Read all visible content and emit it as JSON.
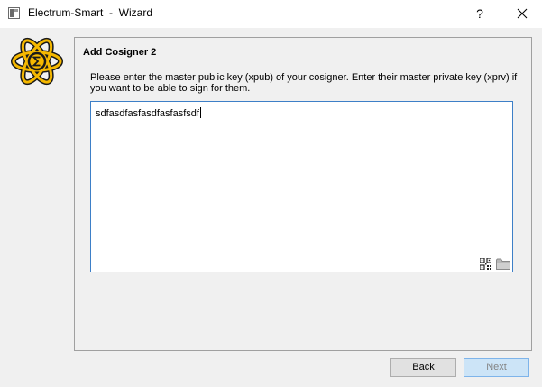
{
  "window": {
    "title": "Electrum-Smart  -  Wizard",
    "help_label": "?"
  },
  "page": {
    "heading": "Add Cosigner 2",
    "instructions": "Please enter the master public key (xpub) of your cosigner. Enter their master private key (xprv) if you want to be able to sign for them.",
    "key_input_value": "sdfasdfasfasdfasfasfsdf"
  },
  "buttons": {
    "back_label": "Back",
    "next_label": "Next",
    "next_enabled": false
  },
  "colors": {
    "logo_fill": "#f5b800",
    "logo_outline": "#1a1a1a",
    "input_focus_border": "#3d7fc7",
    "next_button_bg": "#cce4f7"
  },
  "icons": {
    "app": "window-icon",
    "logo": "electrum-smart-logo",
    "close": "close-icon",
    "qr": "qr-code-icon",
    "folder": "folder-icon"
  }
}
